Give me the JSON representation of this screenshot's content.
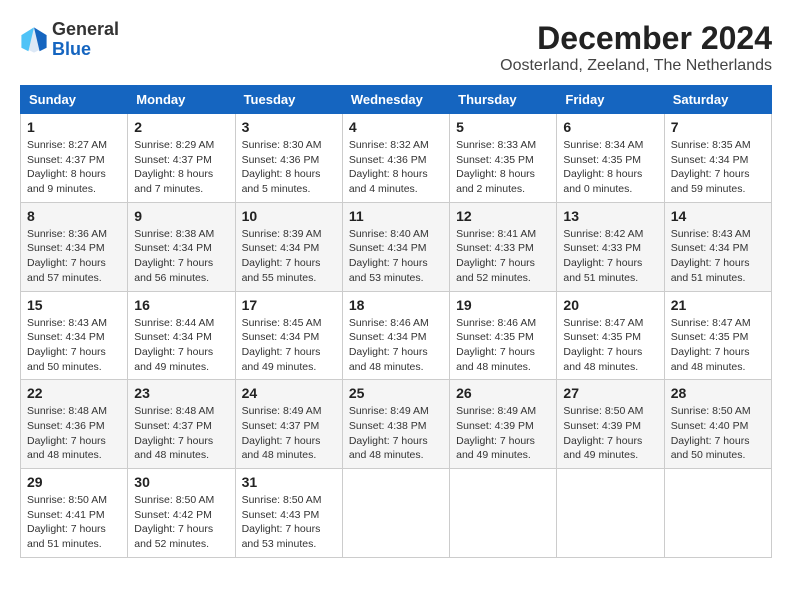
{
  "header": {
    "logo_general": "General",
    "logo_blue": "Blue",
    "month": "December 2024",
    "location": "Oosterland, Zeeland, The Netherlands"
  },
  "days_of_week": [
    "Sunday",
    "Monday",
    "Tuesday",
    "Wednesday",
    "Thursday",
    "Friday",
    "Saturday"
  ],
  "weeks": [
    [
      {
        "day": "1",
        "sunrise": "8:27 AM",
        "sunset": "4:37 PM",
        "daylight": "8 hours and 9 minutes."
      },
      {
        "day": "2",
        "sunrise": "8:29 AM",
        "sunset": "4:37 PM",
        "daylight": "8 hours and 7 minutes."
      },
      {
        "day": "3",
        "sunrise": "8:30 AM",
        "sunset": "4:36 PM",
        "daylight": "8 hours and 5 minutes."
      },
      {
        "day": "4",
        "sunrise": "8:32 AM",
        "sunset": "4:36 PM",
        "daylight": "8 hours and 4 minutes."
      },
      {
        "day": "5",
        "sunrise": "8:33 AM",
        "sunset": "4:35 PM",
        "daylight": "8 hours and 2 minutes."
      },
      {
        "day": "6",
        "sunrise": "8:34 AM",
        "sunset": "4:35 PM",
        "daylight": "8 hours and 0 minutes."
      },
      {
        "day": "7",
        "sunrise": "8:35 AM",
        "sunset": "4:34 PM",
        "daylight": "7 hours and 59 minutes."
      }
    ],
    [
      {
        "day": "8",
        "sunrise": "8:36 AM",
        "sunset": "4:34 PM",
        "daylight": "7 hours and 57 minutes."
      },
      {
        "day": "9",
        "sunrise": "8:38 AM",
        "sunset": "4:34 PM",
        "daylight": "7 hours and 56 minutes."
      },
      {
        "day": "10",
        "sunrise": "8:39 AM",
        "sunset": "4:34 PM",
        "daylight": "7 hours and 55 minutes."
      },
      {
        "day": "11",
        "sunrise": "8:40 AM",
        "sunset": "4:34 PM",
        "daylight": "7 hours and 53 minutes."
      },
      {
        "day": "12",
        "sunrise": "8:41 AM",
        "sunset": "4:33 PM",
        "daylight": "7 hours and 52 minutes."
      },
      {
        "day": "13",
        "sunrise": "8:42 AM",
        "sunset": "4:33 PM",
        "daylight": "7 hours and 51 minutes."
      },
      {
        "day": "14",
        "sunrise": "8:43 AM",
        "sunset": "4:34 PM",
        "daylight": "7 hours and 51 minutes."
      }
    ],
    [
      {
        "day": "15",
        "sunrise": "8:43 AM",
        "sunset": "4:34 PM",
        "daylight": "7 hours and 50 minutes."
      },
      {
        "day": "16",
        "sunrise": "8:44 AM",
        "sunset": "4:34 PM",
        "daylight": "7 hours and 49 minutes."
      },
      {
        "day": "17",
        "sunrise": "8:45 AM",
        "sunset": "4:34 PM",
        "daylight": "7 hours and 49 minutes."
      },
      {
        "day": "18",
        "sunrise": "8:46 AM",
        "sunset": "4:34 PM",
        "daylight": "7 hours and 48 minutes."
      },
      {
        "day": "19",
        "sunrise": "8:46 AM",
        "sunset": "4:35 PM",
        "daylight": "7 hours and 48 minutes."
      },
      {
        "day": "20",
        "sunrise": "8:47 AM",
        "sunset": "4:35 PM",
        "daylight": "7 hours and 48 minutes."
      },
      {
        "day": "21",
        "sunrise": "8:47 AM",
        "sunset": "4:35 PM",
        "daylight": "7 hours and 48 minutes."
      }
    ],
    [
      {
        "day": "22",
        "sunrise": "8:48 AM",
        "sunset": "4:36 PM",
        "daylight": "7 hours and 48 minutes."
      },
      {
        "day": "23",
        "sunrise": "8:48 AM",
        "sunset": "4:37 PM",
        "daylight": "7 hours and 48 minutes."
      },
      {
        "day": "24",
        "sunrise": "8:49 AM",
        "sunset": "4:37 PM",
        "daylight": "7 hours and 48 minutes."
      },
      {
        "day": "25",
        "sunrise": "8:49 AM",
        "sunset": "4:38 PM",
        "daylight": "7 hours and 48 minutes."
      },
      {
        "day": "26",
        "sunrise": "8:49 AM",
        "sunset": "4:39 PM",
        "daylight": "7 hours and 49 minutes."
      },
      {
        "day": "27",
        "sunrise": "8:50 AM",
        "sunset": "4:39 PM",
        "daylight": "7 hours and 49 minutes."
      },
      {
        "day": "28",
        "sunrise": "8:50 AM",
        "sunset": "4:40 PM",
        "daylight": "7 hours and 50 minutes."
      }
    ],
    [
      {
        "day": "29",
        "sunrise": "8:50 AM",
        "sunset": "4:41 PM",
        "daylight": "7 hours and 51 minutes."
      },
      {
        "day": "30",
        "sunrise": "8:50 AM",
        "sunset": "4:42 PM",
        "daylight": "7 hours and 52 minutes."
      },
      {
        "day": "31",
        "sunrise": "8:50 AM",
        "sunset": "4:43 PM",
        "daylight": "7 hours and 53 minutes."
      },
      null,
      null,
      null,
      null
    ]
  ]
}
